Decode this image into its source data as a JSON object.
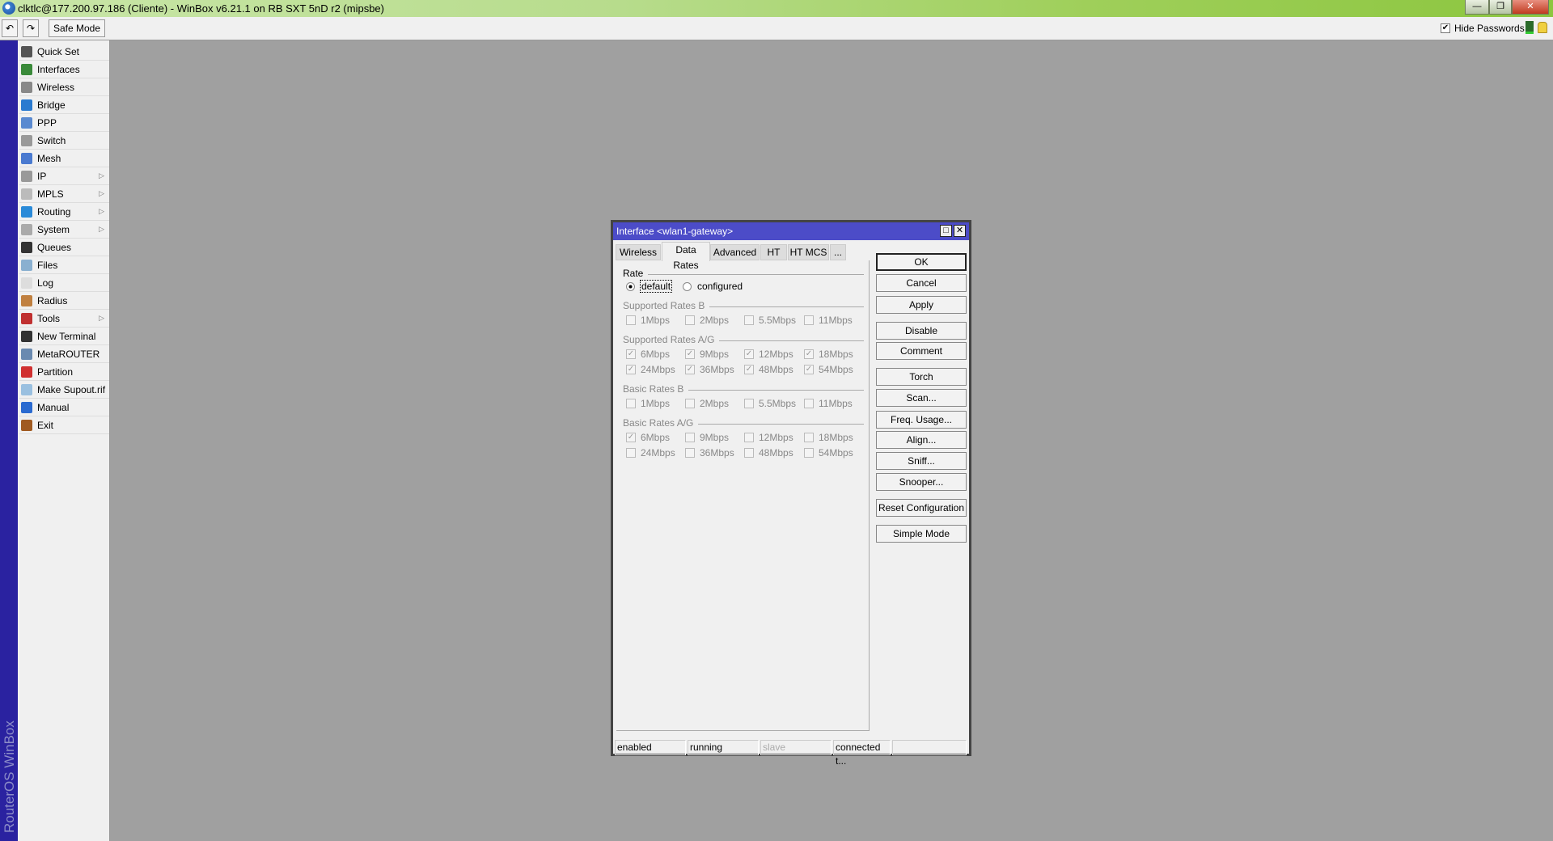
{
  "window": {
    "title": "clktlc@177.200.97.186 (Cliente) - WinBox v6.21.1 on RB SXT 5nD r2 (mipsbe)",
    "min": "—",
    "restore": "❐",
    "close": "✕"
  },
  "toolbar": {
    "undo": "↶",
    "redo": "↷",
    "safe_mode": "Safe Mode",
    "hide_passwords": "Hide Passwords",
    "hide_passwords_checked": true
  },
  "sidebar": {
    "brand": "RouterOS WinBox",
    "items": [
      {
        "label": "Quick Set",
        "icon": "wand-icon",
        "color": "#555"
      },
      {
        "label": "Interfaces",
        "icon": "interfaces-icon",
        "color": "#3a8a3a"
      },
      {
        "label": "Wireless",
        "icon": "wireless-icon",
        "color": "#888"
      },
      {
        "label": "Bridge",
        "icon": "bridge-icon",
        "color": "#2a7ad0"
      },
      {
        "label": "PPP",
        "icon": "ppp-icon",
        "color": "#5a8ad0"
      },
      {
        "label": "Switch",
        "icon": "switch-icon",
        "color": "#999"
      },
      {
        "label": "Mesh",
        "icon": "mesh-icon",
        "color": "#4a7ad0"
      },
      {
        "label": "IP",
        "icon": "ip-icon",
        "color": "#999",
        "sub": true
      },
      {
        "label": "MPLS",
        "icon": "mpls-icon",
        "color": "#bbb",
        "sub": true
      },
      {
        "label": "Routing",
        "icon": "routing-icon",
        "color": "#2a8ad8",
        "sub": true
      },
      {
        "label": "System",
        "icon": "system-icon",
        "color": "#aaa",
        "sub": true
      },
      {
        "label": "Queues",
        "icon": "queues-icon",
        "color": "#333"
      },
      {
        "label": "Files",
        "icon": "files-icon",
        "color": "#8ab0d0"
      },
      {
        "label": "Log",
        "icon": "log-icon",
        "color": "#ddd"
      },
      {
        "label": "Radius",
        "icon": "radius-icon",
        "color": "#c08040"
      },
      {
        "label": "Tools",
        "icon": "tools-icon",
        "color": "#c03030",
        "sub": true
      },
      {
        "label": "New Terminal",
        "icon": "terminal-icon",
        "color": "#333"
      },
      {
        "label": "MetaROUTER",
        "icon": "metarouter-icon",
        "color": "#6a8ab0"
      },
      {
        "label": "Partition",
        "icon": "partition-icon",
        "color": "#d03030"
      },
      {
        "label": "Make Supout.rif",
        "icon": "supout-icon",
        "color": "#9ac0e0"
      },
      {
        "label": "Manual",
        "icon": "manual-icon",
        "color": "#2a6ad0"
      },
      {
        "label": "Exit",
        "icon": "exit-icon",
        "color": "#a05a20"
      }
    ]
  },
  "dialog": {
    "title": "Interface <wlan1-gateway>",
    "tabs": [
      "Wireless",
      "Data Rates",
      "Advanced",
      "HT",
      "HT MCS",
      "..."
    ],
    "active_tab": "Data Rates",
    "rate": {
      "label": "Rate",
      "options": [
        "default",
        "configured"
      ],
      "selected": "default"
    },
    "sections": [
      {
        "label": "Supported Rates B",
        "rows": [
          [
            {
              "l": "1Mbps",
              "c": false
            },
            {
              "l": "2Mbps",
              "c": false
            },
            {
              "l": "5.5Mbps",
              "c": false
            },
            {
              "l": "11Mbps",
              "c": false
            }
          ]
        ]
      },
      {
        "label": "Supported Rates A/G",
        "rows": [
          [
            {
              "l": "6Mbps",
              "c": true
            },
            {
              "l": "9Mbps",
              "c": true
            },
            {
              "l": "12Mbps",
              "c": true
            },
            {
              "l": "18Mbps",
              "c": true
            }
          ],
          [
            {
              "l": "24Mbps",
              "c": true
            },
            {
              "l": "36Mbps",
              "c": true
            },
            {
              "l": "48Mbps",
              "c": true
            },
            {
              "l": "54Mbps",
              "c": true
            }
          ]
        ]
      },
      {
        "label": "Basic Rates B",
        "rows": [
          [
            {
              "l": "1Mbps",
              "c": false
            },
            {
              "l": "2Mbps",
              "c": false
            },
            {
              "l": "5.5Mbps",
              "c": false
            },
            {
              "l": "11Mbps",
              "c": false
            }
          ]
        ]
      },
      {
        "label": "Basic Rates A/G",
        "rows": [
          [
            {
              "l": "6Mbps",
              "c": true
            },
            {
              "l": "9Mbps",
              "c": false
            },
            {
              "l": "12Mbps",
              "c": false
            },
            {
              "l": "18Mbps",
              "c": false
            }
          ],
          [
            {
              "l": "24Mbps",
              "c": false
            },
            {
              "l": "36Mbps",
              "c": false
            },
            {
              "l": "48Mbps",
              "c": false
            },
            {
              "l": "54Mbps",
              "c": false
            }
          ]
        ]
      }
    ],
    "buttons": [
      "OK",
      "Cancel",
      "Apply",
      "Disable",
      "Comment",
      "Torch",
      "Scan...",
      "Freq. Usage...",
      "Align...",
      "Sniff...",
      "Snooper...",
      "Reset Configuration",
      "Simple Mode"
    ],
    "status": [
      "enabled",
      "running",
      "slave",
      "connected t...",
      ""
    ]
  }
}
